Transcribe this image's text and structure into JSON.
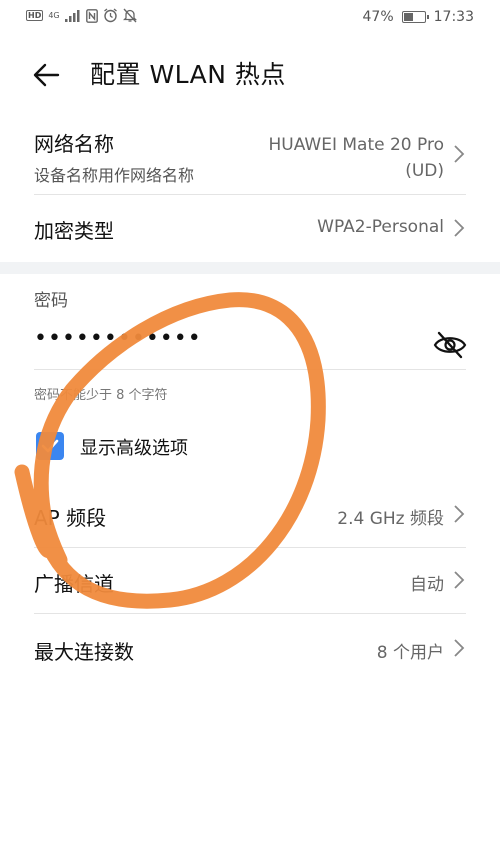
{
  "status_bar": {
    "left_badges": [
      "HD",
      "4G"
    ],
    "battery_percent_label": "47%",
    "battery_level": 0.47,
    "time": "17:33",
    "icons": [
      "signal-icon",
      "nfc-icon",
      "alarm-icon",
      "mute-icon",
      "battery-icon"
    ]
  },
  "header": {
    "title": "配置 WLAN 热点"
  },
  "rows": {
    "network_name": {
      "label": "网络名称",
      "sublabel": "设备名称用作网络名称",
      "value_line1": "HUAWEI Mate 20 Pro",
      "value_line2": "(UD)"
    },
    "encryption": {
      "label": "加密类型",
      "value": "WPA2-Personal"
    },
    "ap_band": {
      "label": "AP 频段",
      "value": "2.4 GHz 频段"
    },
    "broadcast_channel": {
      "label": "广播信道",
      "value": "自动"
    },
    "max_connections": {
      "label": "最大连接数",
      "value": "8 个用户"
    }
  },
  "password": {
    "label": "密码",
    "value": "••••••••••••",
    "hint": "密码不能少于 8 个字符"
  },
  "advanced": {
    "label": "显示高级选项",
    "checked": true
  },
  "colors": {
    "accent": "#3b86f0",
    "annotation": "#f08a3c",
    "section_bg": "#f1f3f5"
  }
}
